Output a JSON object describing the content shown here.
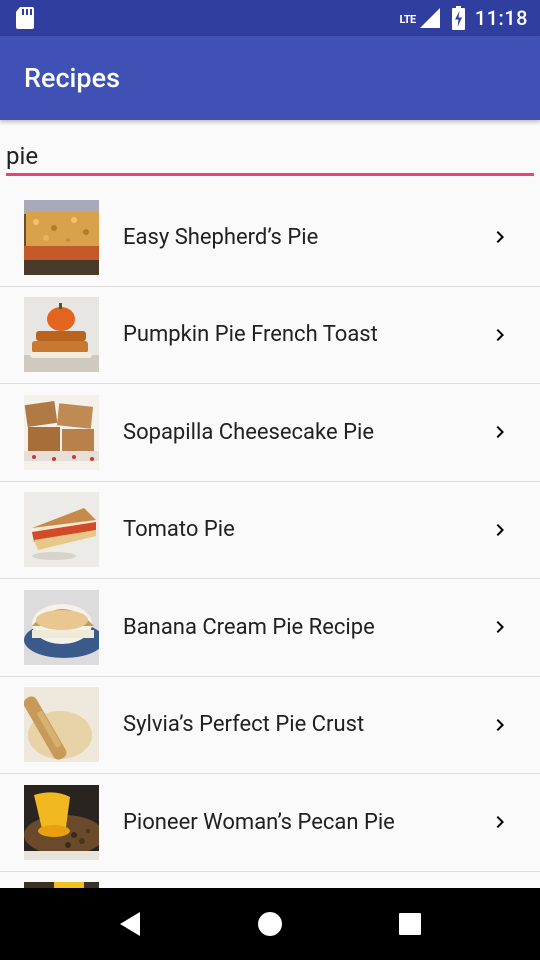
{
  "status_bar": {
    "network_label": "LTE",
    "time": "11:18"
  },
  "app_bar": {
    "title": "Recipes"
  },
  "search": {
    "value": "pie"
  },
  "recipes": [
    {
      "name": "Easy Shepherd’s Pie",
      "thumbnail": "shepherds-pie-photo"
    },
    {
      "name": "Pumpkin Pie French Toast",
      "thumbnail": "pumpkin-french-toast-photo"
    },
    {
      "name": "Sopapilla Cheesecake Pie",
      "thumbnail": "sopapilla-photo"
    },
    {
      "name": "Tomato Pie",
      "thumbnail": "tomato-pie-photo"
    },
    {
      "name": "Banana Cream Pie Recipe",
      "thumbnail": "banana-cream-pie-photo"
    },
    {
      "name": "Sylvia’s Perfect Pie Crust",
      "thumbnail": "pie-crust-photo"
    },
    {
      "name": "Pioneer Woman’s Pecan Pie",
      "thumbnail": "pecan-pie-photo"
    },
    {
      "name": "",
      "thumbnail": "partial-photo"
    }
  ],
  "nav_bar": {
    "back": "back-icon",
    "home": "home-icon",
    "recents": "recents-icon"
  },
  "colors": {
    "primary": "#3f51b5",
    "primary_dark": "#303f9f",
    "accent": "#ec407a"
  }
}
